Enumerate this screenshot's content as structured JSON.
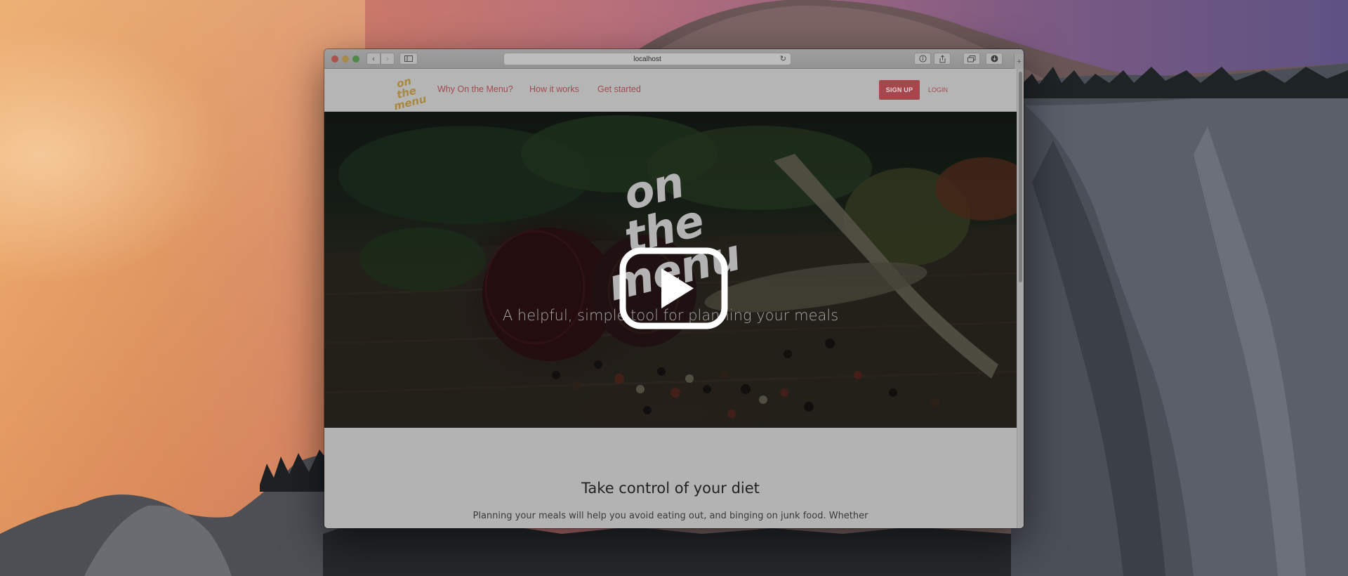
{
  "browser": {
    "address": "localhost"
  },
  "site": {
    "logo_text_line1": "on the",
    "logo_text_line2": "menu",
    "nav": {
      "why": "Why On the Menu?",
      "how": "How it works",
      "get_started": "Get started"
    },
    "signup_label": "SIGN UP",
    "login_label": "LOGIN"
  },
  "hero": {
    "logo_line1": "on the",
    "logo_line2": "menu",
    "tagline": "A helpful, simple tool for planning your meals"
  },
  "section": {
    "title": "Take control of your diet",
    "body": "Planning your meals will help you avoid eating out, and binging on junk food. Whether"
  },
  "colors": {
    "accent": "#a5474d",
    "link": "#a04b52",
    "logo": "#a8893f"
  }
}
